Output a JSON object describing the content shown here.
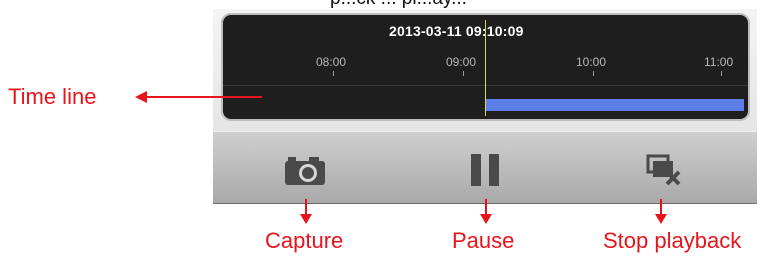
{
  "header_partial_text": "p...ck     ... pl...ay...",
  "timeline": {
    "current_datetime": "2013-03-11 09:10:09",
    "ticks": [
      "08:00",
      "09:00",
      "10:00",
      "11:00"
    ],
    "recording_color": "#5b7fe6",
    "cursor_color": "#e3d54a"
  },
  "controls": {
    "capture_icon": "camera-icon",
    "pause_icon": "pause-icon",
    "stop_icon": "stop-playback-icon"
  },
  "annotations": {
    "timeline_label": "Time line",
    "capture_label": "Capture",
    "pause_label": "Pause",
    "stop_label": "Stop playback",
    "color": "#e8141b"
  }
}
